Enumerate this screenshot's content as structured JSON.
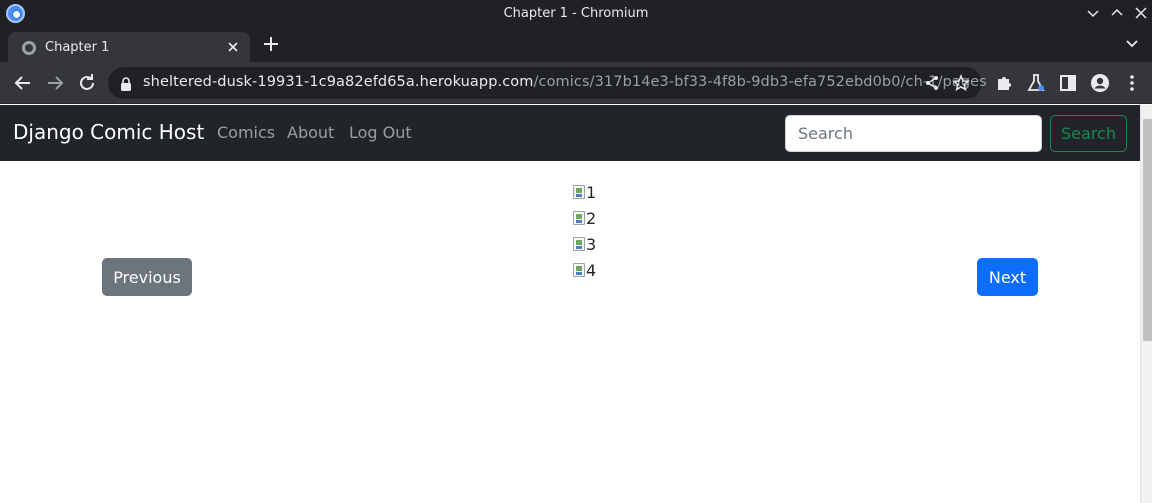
{
  "window": {
    "title": "Chapter 1 - Chromium"
  },
  "tabs": [
    {
      "label": "Chapter 1"
    }
  ],
  "address_bar": {
    "host": "sheltered-dusk-19931-1c9a82efd65a.herokuapp.com",
    "path": "/comics/317b14e3-bf33-4f8b-9db3-efa752ebd0b0/ch-1/pages"
  },
  "navbar": {
    "brand": "Django Comic Host",
    "links": [
      "Comics",
      "About",
      "Log Out"
    ],
    "search_placeholder": "Search",
    "search_button": "Search"
  },
  "reader": {
    "previous_label": "Previous",
    "next_label": "Next",
    "page_alts": [
      "1",
      "2",
      "3",
      "4"
    ]
  },
  "colors": {
    "navbar_bg": "#212529",
    "previous_bg": "#6c757d",
    "next_bg": "#0d6efd",
    "search_outline": "#198754"
  }
}
